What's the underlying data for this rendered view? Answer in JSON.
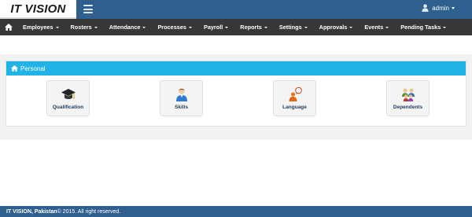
{
  "header": {
    "logo_text": "IT VISION",
    "user_name": "admin",
    "bar_color": "#2e5f8e"
  },
  "nav": {
    "home_icon": "home-icon",
    "items": [
      {
        "label": "Employees"
      },
      {
        "label": "Rosters"
      },
      {
        "label": "Attendance"
      },
      {
        "label": "Processes"
      },
      {
        "label": "Payroll"
      },
      {
        "label": "Reports"
      },
      {
        "label": "Settings"
      },
      {
        "label": "Approvals"
      },
      {
        "label": "Events"
      },
      {
        "label": "Pending Tasks"
      }
    ]
  },
  "panel": {
    "title": "Personal",
    "header_color": "#21b2e6",
    "tiles": [
      {
        "label": "Qualification",
        "icon": "graduation-cap-icon"
      },
      {
        "label": "Skills",
        "icon": "person-icon"
      },
      {
        "label": "Language",
        "icon": "speech-person-icon"
      },
      {
        "label": "Dependents",
        "icon": "family-icon"
      }
    ]
  },
  "footer": {
    "company": "IT VISION, Pakistan",
    "rest": " © 2015. All right reserved."
  }
}
